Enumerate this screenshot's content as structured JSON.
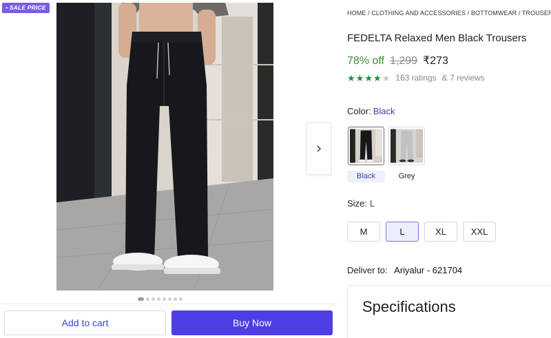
{
  "badge": {
    "label": "SALE PRICE"
  },
  "gallery": {
    "dots_count": 8,
    "active_dot": 0
  },
  "breadcrumb": {
    "text": "HOME / CLOTHING AND ACCESSORIES / BOTTOMWEAR / TROUSERS / M"
  },
  "product": {
    "title": "FEDELTA Relaxed Men Black Trousers",
    "discount": "78% off",
    "mrp": "1,299",
    "price": "₹273",
    "rating_value": 3.5,
    "ratings_text": "163 ratings",
    "reviews_text": "& 7 reviews"
  },
  "color": {
    "label": "Color:",
    "selected": "Black",
    "options": [
      {
        "name": "Black"
      },
      {
        "name": "Grey"
      }
    ]
  },
  "size": {
    "label": "Size:",
    "selected": "L",
    "options": [
      "M",
      "L",
      "XL",
      "XXL"
    ]
  },
  "delivery": {
    "label": "Deliver to:",
    "location": "Ariyalur - 621704"
  },
  "specifications": {
    "title": "Specifications"
  },
  "actions": {
    "add_to_cart": "Add to cart",
    "buy_now": "Buy Now"
  },
  "colors": {
    "accent": "#4d3ee6",
    "discount_green": "#388e3c",
    "star_green": "#1e8e3e",
    "link_purple": "#3f3fa8"
  },
  "icons": {
    "next": "chevron-right-icon",
    "star": "star-icon"
  }
}
